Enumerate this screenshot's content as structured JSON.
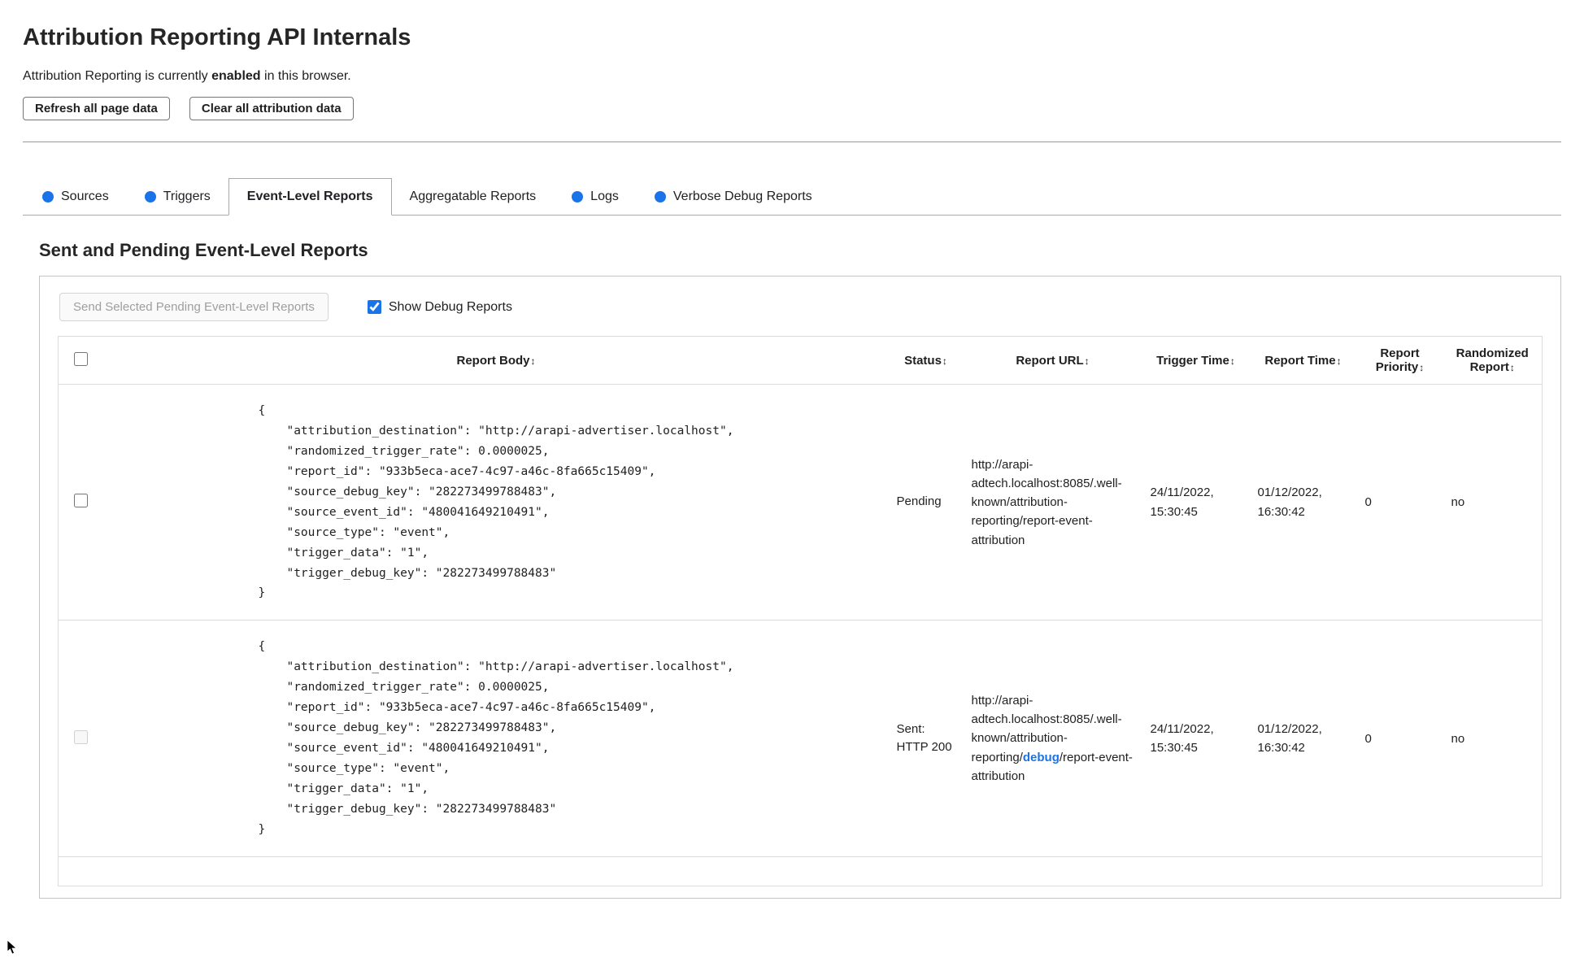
{
  "page": {
    "title": "Attribution Reporting API Internals",
    "status_prefix": "Attribution Reporting is currently ",
    "status_bold": "enabled",
    "status_suffix": " in this browser.",
    "refresh_button": "Refresh all page data",
    "clear_button": "Clear all attribution data"
  },
  "tabs": [
    {
      "label": "Sources",
      "dot": true,
      "active": false
    },
    {
      "label": "Triggers",
      "dot": true,
      "active": false
    },
    {
      "label": "Event-Level Reports",
      "dot": false,
      "active": true
    },
    {
      "label": "Aggregatable Reports",
      "dot": false,
      "active": false
    },
    {
      "label": "Logs",
      "dot": true,
      "active": false
    },
    {
      "label": "Verbose Debug Reports",
      "dot": true,
      "active": false
    }
  ],
  "section": {
    "heading": "Sent and Pending Event-Level Reports",
    "send_button": "Send Selected Pending Event-Level Reports",
    "show_debug_label": "Show Debug Reports",
    "show_debug_checked": true
  },
  "table": {
    "sort_icon": "↕",
    "headers": [
      "Report Body",
      "Status",
      "Report URL",
      "Trigger Time",
      "Report Time",
      "Report Priority",
      "Randomized Report"
    ],
    "rows": [
      {
        "selectable": true,
        "body": "{\n    \"attribution_destination\": \"http://arapi-advertiser.localhost\",\n    \"randomized_trigger_rate\": 0.0000025,\n    \"report_id\": \"933b5eca-ace7-4c97-a46c-8fa665c15409\",\n    \"source_debug_key\": \"282273499788483\",\n    \"source_event_id\": \"480041649210491\",\n    \"source_type\": \"event\",\n    \"trigger_data\": \"1\",\n    \"trigger_debug_key\": \"282273499788483\"\n}",
        "status": "Pending",
        "url_prefix": "http://arapi-adtech.localhost:8085/.well-known/attribution-reporting/",
        "url_debug": "",
        "url_suffix": "report-event-attribution",
        "trigger_time": "24/11/2022, 15:30:45",
        "report_time": "01/12/2022, 16:30:42",
        "priority": "0",
        "randomized": "no"
      },
      {
        "selectable": false,
        "body": "{\n    \"attribution_destination\": \"http://arapi-advertiser.localhost\",\n    \"randomized_trigger_rate\": 0.0000025,\n    \"report_id\": \"933b5eca-ace7-4c97-a46c-8fa665c15409\",\n    \"source_debug_key\": \"282273499788483\",\n    \"source_event_id\": \"480041649210491\",\n    \"source_type\": \"event\",\n    \"trigger_data\": \"1\",\n    \"trigger_debug_key\": \"282273499788483\"\n}",
        "status": "Sent: HTTP 200",
        "url_prefix": "http://arapi-adtech.localhost:8085/.well-known/attribution-reporting/",
        "url_debug": "debug",
        "url_suffix": "/report-event-attribution",
        "trigger_time": "24/11/2022, 15:30:45",
        "report_time": "01/12/2022, 16:30:42",
        "priority": "0",
        "randomized": "no"
      }
    ]
  },
  "colors": {
    "accent_blue": "#1a73e8"
  }
}
